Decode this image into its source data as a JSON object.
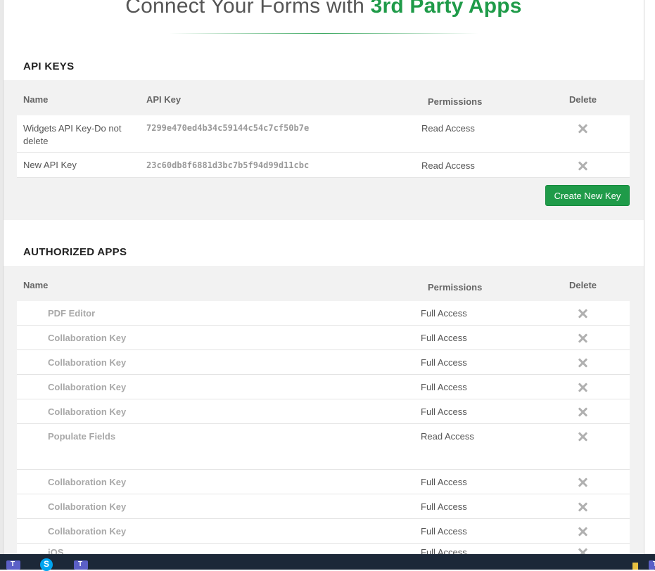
{
  "header": {
    "title_prefix": "Connect Your Forms with ",
    "title_accent": "3rd Party Apps"
  },
  "api_keys": {
    "section_title": "API KEYS",
    "columns": {
      "name": "Name",
      "api_key": "API Key",
      "permissions": "Permissions",
      "delete": "Delete"
    },
    "rows": [
      {
        "name_line1": "Widgets API Key-Do not",
        "name_line2": "delete",
        "key": "7299e470ed4b34c59144c54c7cf50b7e",
        "permission": "Read Access"
      },
      {
        "name_line1": "New API Key",
        "name_line2": "",
        "key": "23c60db8f6881d3bc7b5f94d99d11cbc",
        "permission": "Read Access"
      }
    ],
    "create_button_label": "Create New Key"
  },
  "authorized_apps": {
    "section_title": "AUTHORIZED APPS",
    "columns": {
      "name": "Name",
      "permissions": "Permissions",
      "delete": "Delete"
    },
    "rows": [
      {
        "name": "PDF Editor",
        "permission": "Full Access"
      },
      {
        "name": "Collaboration Key",
        "permission": "Full Access"
      },
      {
        "name": "Collaboration Key",
        "permission": "Full Access"
      },
      {
        "name": "Collaboration Key",
        "permission": "Full Access"
      },
      {
        "name": "Collaboration Key",
        "permission": "Full Access"
      },
      {
        "name": "Populate Fields",
        "permission": "Read Access"
      },
      {
        "name": "Collaboration Key",
        "permission": "Full Access"
      },
      {
        "name": "Collaboration Key",
        "permission": "Full Access"
      },
      {
        "name": "Collaboration Key",
        "permission": "Full Access"
      },
      {
        "name": "iOS",
        "permission": "Full Access"
      }
    ]
  },
  "colors": {
    "accent": "#1f9b49",
    "panel": "#f2f2f2",
    "taskbar": "#1c2838"
  },
  "taskbar": {
    "icons": [
      "teams-icon",
      "skype-icon",
      "teams-icon"
    ]
  }
}
